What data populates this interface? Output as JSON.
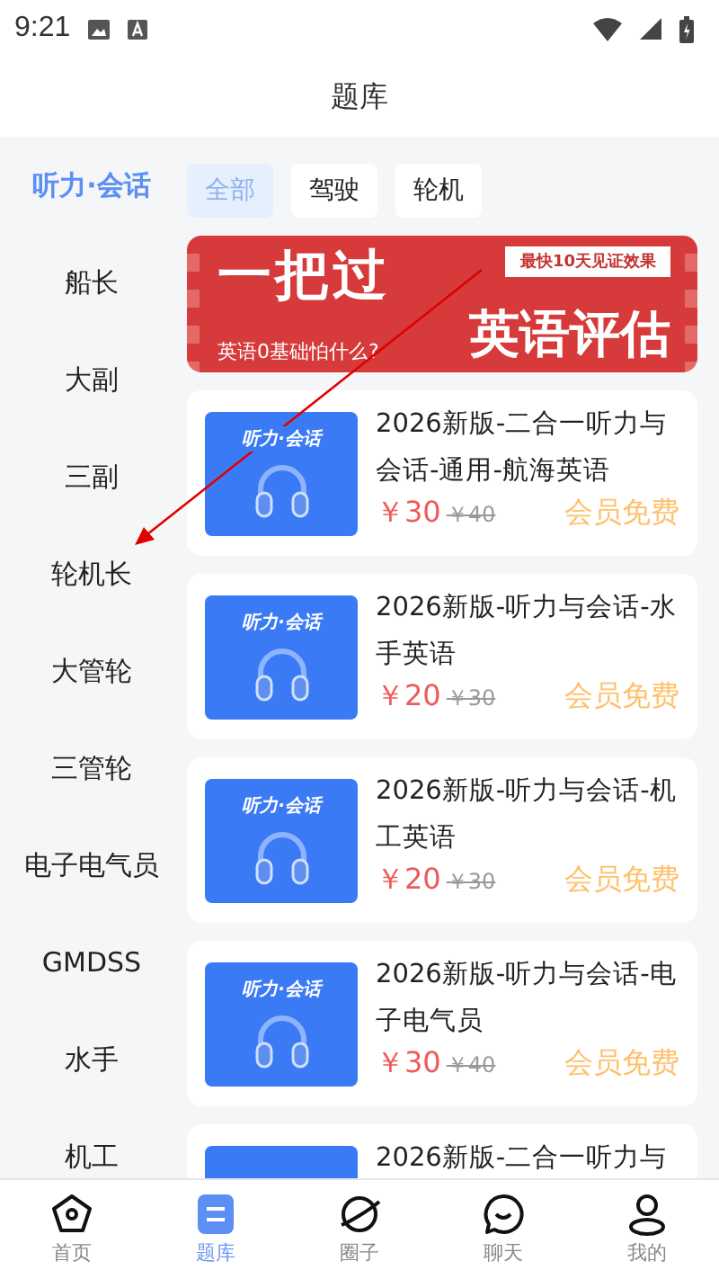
{
  "status_bar": {
    "time": "9:21"
  },
  "header": {
    "title": "题库"
  },
  "sidebar": {
    "items": [
      {
        "label": "听力·会话",
        "selected": true
      },
      {
        "label": "船长",
        "selected": false
      },
      {
        "label": "大副",
        "selected": false
      },
      {
        "label": "三副",
        "selected": false
      },
      {
        "label": "轮机长",
        "selected": false
      },
      {
        "label": "大管轮",
        "selected": false
      },
      {
        "label": "三管轮",
        "selected": false
      },
      {
        "label": "电子电气员",
        "selected": false
      },
      {
        "label": "GMDSS",
        "selected": false
      },
      {
        "label": "水手",
        "selected": false
      },
      {
        "label": "机工",
        "selected": false
      }
    ]
  },
  "filter_tabs": [
    {
      "label": "全部",
      "selected": true
    },
    {
      "label": "驾驶",
      "selected": false
    },
    {
      "label": "轮机",
      "selected": false
    }
  ],
  "banner": {
    "headline": "一把过",
    "tag": "最快10天见证效果",
    "subtitle": "英语0基础怕什么?",
    "title": "英语评估"
  },
  "courses": [
    {
      "cover_label": "听力·会话",
      "title": "2026新版-二合一听力与会话-通用-航海英语",
      "price": "￥30",
      "old_price": "￥40",
      "member_note": "会员免费"
    },
    {
      "cover_label": "听力·会话",
      "title": "2026新版-听力与会话-水手英语",
      "price": "￥20",
      "old_price": "￥30",
      "member_note": "会员免费"
    },
    {
      "cover_label": "听力·会话",
      "title": "2026新版-听力与会话-机工英语",
      "price": "￥20",
      "old_price": "￥30",
      "member_note": "会员免费"
    },
    {
      "cover_label": "听力·会话",
      "title": "2026新版-听力与会话-电子电气员",
      "price": "￥30",
      "old_price": "￥40",
      "member_note": "会员免费"
    },
    {
      "title": "2026新版-二合一听力与"
    }
  ],
  "bottom_nav": [
    {
      "label": "首页",
      "selected": false
    },
    {
      "label": "题库",
      "selected": true
    },
    {
      "label": "圈子",
      "selected": false
    },
    {
      "label": "聊天",
      "selected": false
    },
    {
      "label": "我的",
      "selected": false
    }
  ]
}
